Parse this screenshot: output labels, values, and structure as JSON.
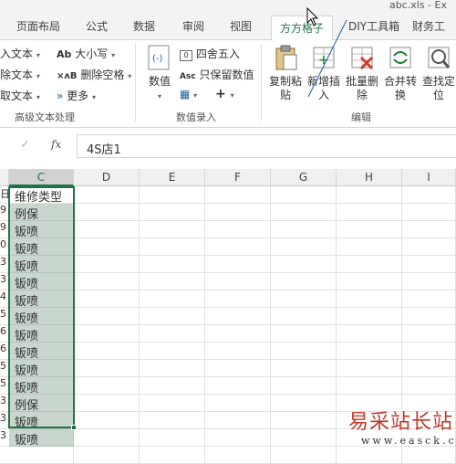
{
  "window": {
    "title": "abc.xls - Ex"
  },
  "tabs": [
    {
      "label": "页面布局",
      "active": false
    },
    {
      "label": "公式",
      "active": false
    },
    {
      "label": "数据",
      "active": false
    },
    {
      "label": "审阅",
      "active": false
    },
    {
      "label": "视图",
      "active": false
    },
    {
      "label": "方方格子",
      "active": true
    },
    {
      "label": "DIY工具箱",
      "active": false
    },
    {
      "label": "财务工",
      "active": false
    }
  ],
  "ribbon": {
    "text_group": {
      "items": [
        "入文本",
        "除文本",
        "取文本"
      ],
      "case_label": "大小写",
      "delete_space_label": "删除空格",
      "more_label": "更多",
      "group_label": "高级文本处理"
    },
    "number_group": {
      "value_label": "数值",
      "round_label": "四舍五入",
      "keep_value_label": "只保留数值",
      "plus_label": "+",
      "group_label": "数值录入"
    },
    "edit_group": {
      "buttons": [
        {
          "label": "复制粘\n贴",
          "icon": "clipboard-icon"
        },
        {
          "label": "新增插\n入",
          "icon": "insert-icon"
        },
        {
          "label": "批量删\n除",
          "icon": "batch-delete-icon"
        },
        {
          "label": "合并转\n换",
          "icon": "merge-convert-icon"
        },
        {
          "label": "查找定\n位",
          "icon": "find-locate-icon"
        }
      ],
      "group_label": "编辑"
    },
    "accent_color": "#217346"
  },
  "formula_bar": {
    "cancel_icon": "✓",
    "fx_label": "fx",
    "value": "4S店1"
  },
  "columns": [
    "C",
    "D",
    "E",
    "F",
    "G",
    "H",
    "I"
  ],
  "selected_column": "C",
  "column_c": {
    "header": "维修类型",
    "values": [
      "例保",
      "钣喷",
      "钣喷",
      "钣喷",
      "钣喷",
      "钣喷",
      "钣喷",
      "钣喷",
      "钣喷",
      "钣喷",
      "钣喷",
      "例保",
      "钣喷",
      "钣喷"
    ]
  },
  "row_stubs": [
    "日",
    "9",
    "9",
    "0",
    "3",
    "3",
    "4",
    "5",
    "6",
    "6",
    "5",
    "5",
    "3",
    "3",
    "3"
  ],
  "watermark": {
    "line1": "易采站长站",
    "line2": "www.easck.com"
  }
}
